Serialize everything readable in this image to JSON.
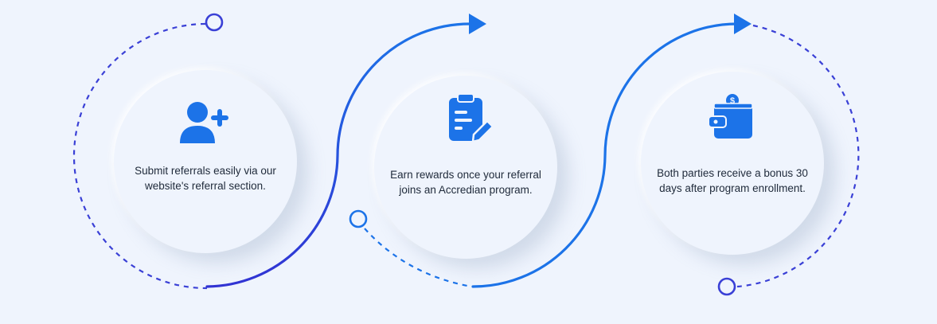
{
  "colors": {
    "background": "#eff4fd",
    "accent": "#1c73e8",
    "accent_dark": "#2b39d6",
    "dashed": "#2e3dd8"
  },
  "steps": [
    {
      "icon": "add-user-icon",
      "text": "Submit referrals easily via our website's referral section."
    },
    {
      "icon": "clipboard-edit-icon",
      "text": "Earn rewards once your referral joins an Accredian program."
    },
    {
      "icon": "wallet-coin-icon",
      "text": "Both parties receive a bonus 30 days after program enrollment."
    }
  ]
}
